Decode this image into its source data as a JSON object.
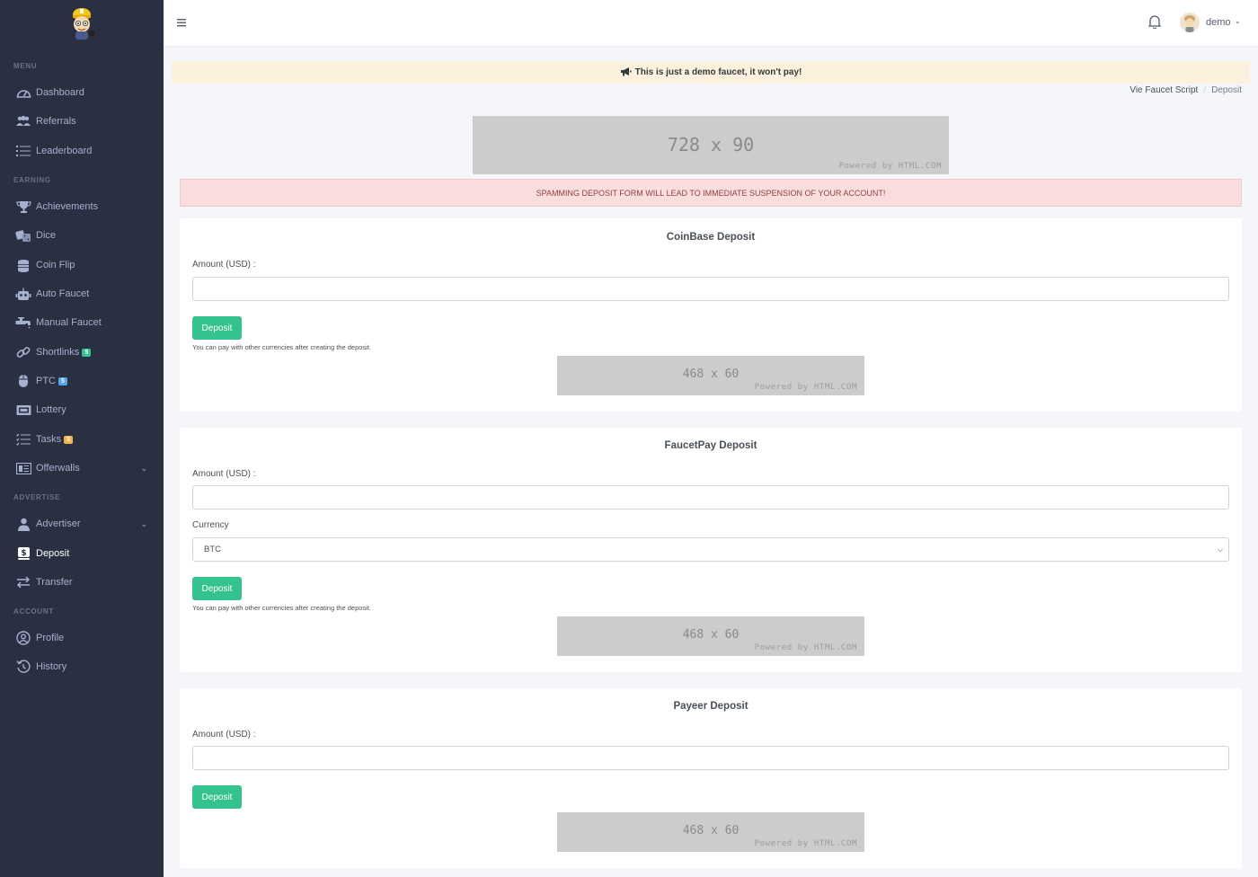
{
  "sidebar": {
    "sections": {
      "menu": "MENU",
      "earning": "EARNING",
      "advertise": "ADVERTISE",
      "account": "ACCOUNT"
    },
    "items": [
      {
        "label": "Dashboard",
        "icon": "dashboard-icon"
      },
      {
        "label": "Referrals",
        "icon": "users-icon"
      },
      {
        "label": "Leaderboard",
        "icon": "list-icon"
      },
      {
        "label": "Achievements",
        "icon": "trophy-icon"
      },
      {
        "label": "Dice",
        "icon": "dice-icon"
      },
      {
        "label": "Coin Flip",
        "icon": "coins-icon"
      },
      {
        "label": "Auto Faucet",
        "icon": "robot-icon"
      },
      {
        "label": "Manual Faucet",
        "icon": "faucet-icon"
      },
      {
        "label": "Shortlinks",
        "icon": "link-icon",
        "badge": "5"
      },
      {
        "label": "PTC",
        "icon": "mouse-icon",
        "badge": "5"
      },
      {
        "label": "Lottery",
        "icon": "ticket-icon"
      },
      {
        "label": "Tasks",
        "icon": "tasks-icon",
        "badge": "3"
      },
      {
        "label": "Offerwalls",
        "icon": "offerwall-icon"
      },
      {
        "label": "Advertiser",
        "icon": "advertiser-icon"
      },
      {
        "label": "Deposit",
        "icon": "deposit-icon"
      },
      {
        "label": "Transfer",
        "icon": "transfer-icon"
      },
      {
        "label": "Profile",
        "icon": "profile-icon"
      },
      {
        "label": "History",
        "icon": "history-icon"
      }
    ]
  },
  "header": {
    "user": "demo"
  },
  "notice": "This is just a demo faucet, it won't pay!",
  "breadcrumb": {
    "root": "Vie Faucet Script",
    "current": "Deposit"
  },
  "ads": {
    "top_size": "728 x 90",
    "small_size": "468 x 60",
    "powered": "Powered by HTML.COM"
  },
  "warning": "SPAMMING DEPOSIT FORM WILL LEAD TO IMMEDIATE SUSPENSION OF YOUR ACCOUNT!",
  "cards": {
    "coinbase": {
      "title": "CoinBase Deposit",
      "amount_label": "Amount (USD) :",
      "button": "Deposit",
      "hint": "You can pay with other currencies after creating the deposit."
    },
    "faucetpay": {
      "title": "FaucetPay Deposit",
      "amount_label": "Amount (USD) :",
      "currency_label": "Currency",
      "currency_value": "BTC",
      "button": "Deposit",
      "hint": "You can pay with other currencies after creating the deposit."
    },
    "payeer": {
      "title": "Payeer Deposit",
      "amount_label": "Amount (USD) :",
      "button": "Deposit"
    }
  },
  "colors": {
    "sidebar_bg": "#2a3042",
    "accent_green": "#34c38f",
    "notice_bg": "#fcf1dc",
    "danger_bg": "#fadede"
  }
}
